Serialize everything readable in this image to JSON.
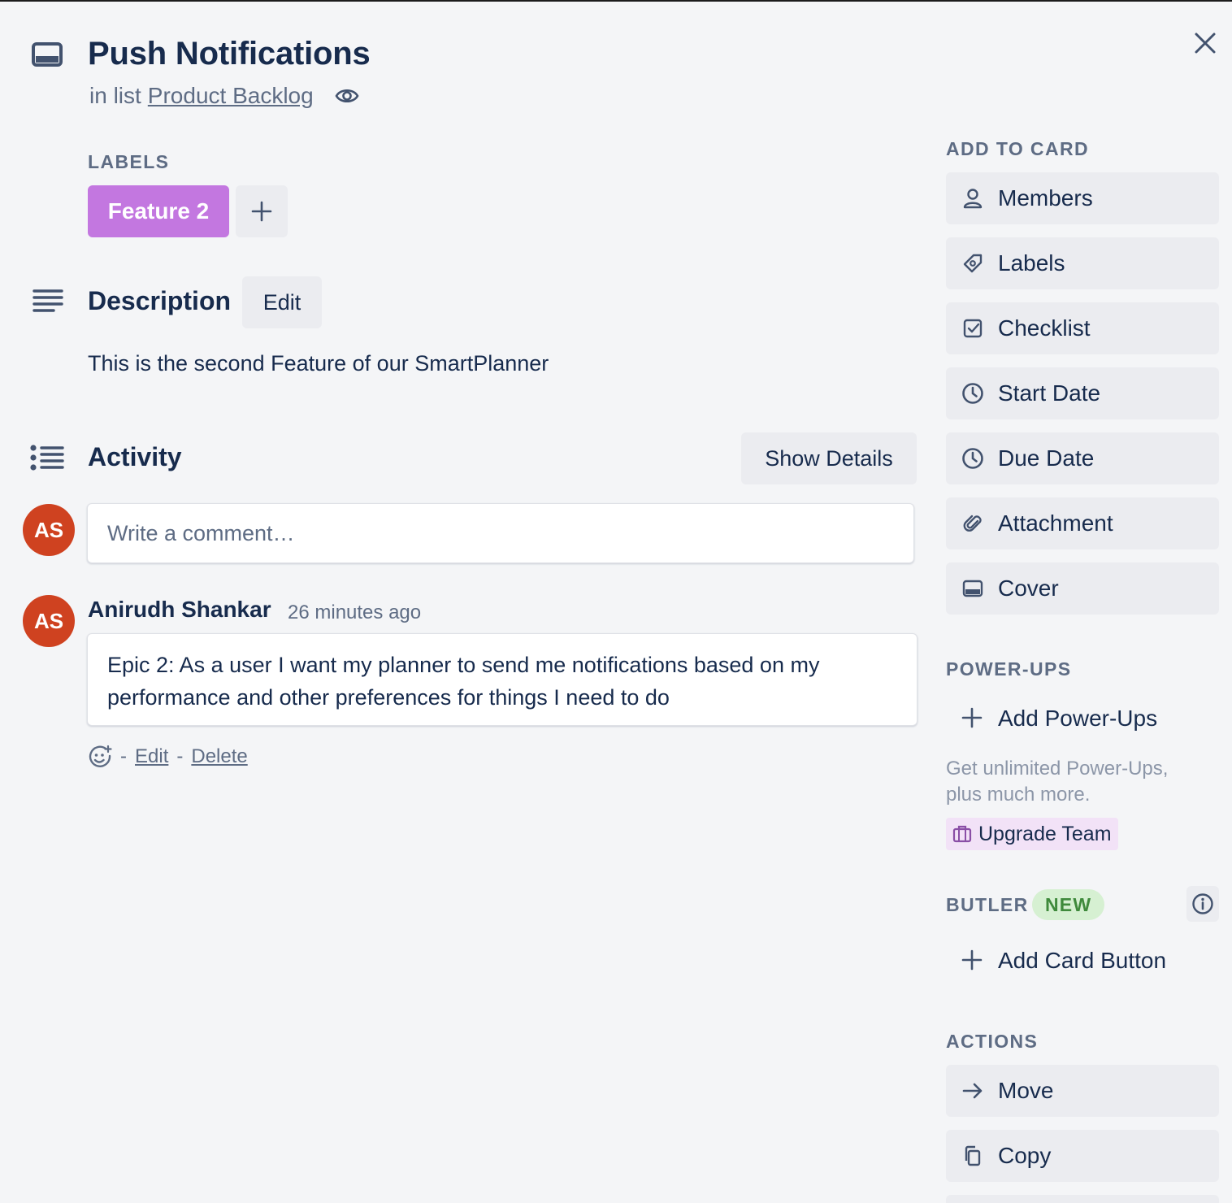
{
  "card": {
    "title": "Push Notifications",
    "in_list_prefix": "in list",
    "list_name": "Product Backlog"
  },
  "labels": {
    "heading": "LABELS",
    "items": [
      {
        "text": "Feature 2",
        "color": "#c377e0"
      }
    ]
  },
  "description": {
    "title": "Description",
    "edit_label": "Edit",
    "text": "This is the second Feature of our SmartPlanner"
  },
  "activity": {
    "title": "Activity",
    "show_details_label": "Show Details",
    "comment_placeholder": "Write a comment…",
    "user_initials": "AS",
    "comments": [
      {
        "author": "Anirudh Shankar",
        "initials": "AS",
        "time": "26 minutes ago",
        "text": "Epic 2: As a user I want my planner to send me notifications based on my performance and other preferences for things I need to do",
        "separator": "-",
        "edit_label": "Edit",
        "delete_label": "Delete"
      }
    ]
  },
  "sidebar": {
    "add_to_card": {
      "heading": "ADD TO CARD",
      "items": [
        {
          "label": "Members",
          "icon": "person-icon"
        },
        {
          "label": "Labels",
          "icon": "tag-icon"
        },
        {
          "label": "Checklist",
          "icon": "checkbox-icon"
        },
        {
          "label": "Start Date",
          "icon": "clock-icon"
        },
        {
          "label": "Due Date",
          "icon": "clock-icon"
        },
        {
          "label": "Attachment",
          "icon": "paperclip-icon"
        },
        {
          "label": "Cover",
          "icon": "card-cover-icon"
        }
      ]
    },
    "power_ups": {
      "heading": "POWER-UPS",
      "add_label": "Add Power-Ups",
      "upsell_text": "Get unlimited Power-Ups, plus much more.",
      "upgrade_label": "Upgrade Team"
    },
    "butler": {
      "heading": "BUTLER",
      "badge": "NEW",
      "add_label": "Add Card Button"
    },
    "actions": {
      "heading": "ACTIONS",
      "items": [
        {
          "label": "Move",
          "icon": "arrow-right-icon"
        },
        {
          "label": "Copy",
          "icon": "copy-icon"
        }
      ]
    }
  },
  "colors": {
    "avatar": "#cf4220",
    "label_purple": "#c377e0",
    "upgrade_bg": "#f2e2f7",
    "new_badge_bg": "#d6f0d2",
    "new_badge_text": "#3f8a3c"
  }
}
